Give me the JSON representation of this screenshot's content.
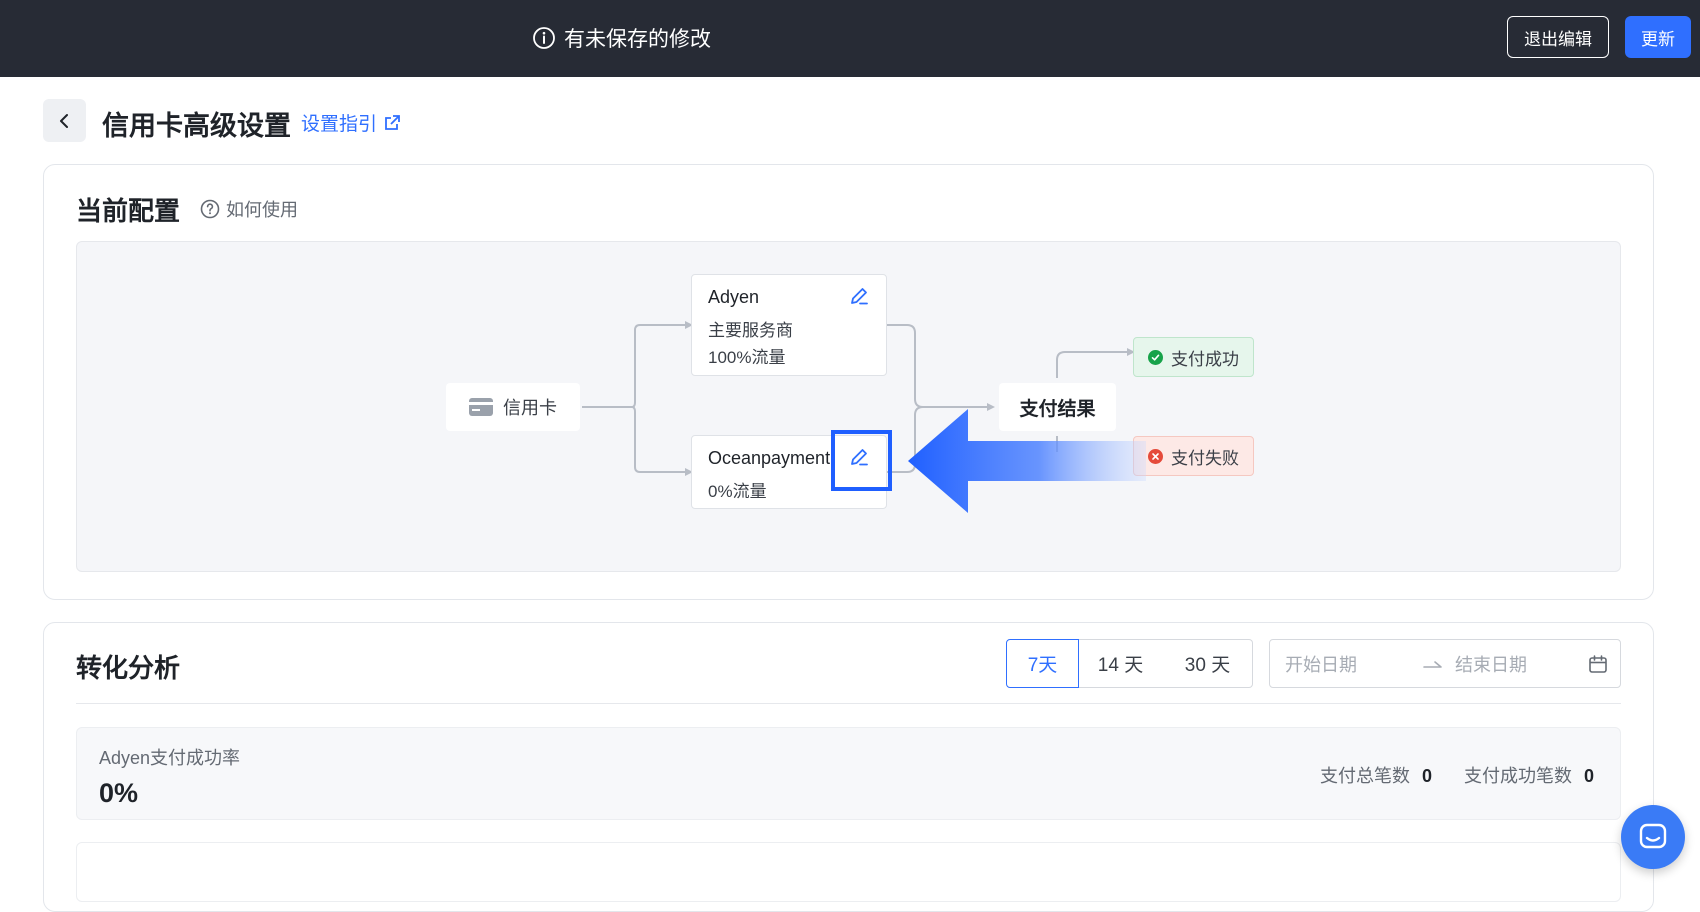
{
  "topbar": {
    "unsaved_text": "有未保存的修改",
    "exit_label": "退出编辑",
    "update_label": "更新"
  },
  "header": {
    "title": "信用卡高级设置",
    "guide_link": "设置指引"
  },
  "config": {
    "title": "当前配置",
    "howto": "如何使用",
    "source_label": "信用卡",
    "providers": [
      {
        "name": "Adyen",
        "role": "主要服务商",
        "traffic": "100%流量"
      },
      {
        "name": "Oceanpayment",
        "traffic": "0%流量"
      }
    ],
    "result_label": "支付结果",
    "success_label": "支付成功",
    "fail_label": "支付失败"
  },
  "analysis": {
    "title": "转化分析",
    "ranges": [
      "7天",
      "14 天",
      "30 天"
    ],
    "selected_range": "7天",
    "start_placeholder": "开始日期",
    "end_placeholder": "结束日期",
    "metric_label": "Adyen支付成功率",
    "metric_value": "0%",
    "total_label": "支付总笔数",
    "total_value": "0",
    "success_count_label": "支付成功笔数",
    "success_count_value": "0"
  },
  "colors": {
    "topbar": "#272b35",
    "accent": "#2f6fff",
    "success": "#17a34a",
    "danger": "#e54a3a"
  }
}
